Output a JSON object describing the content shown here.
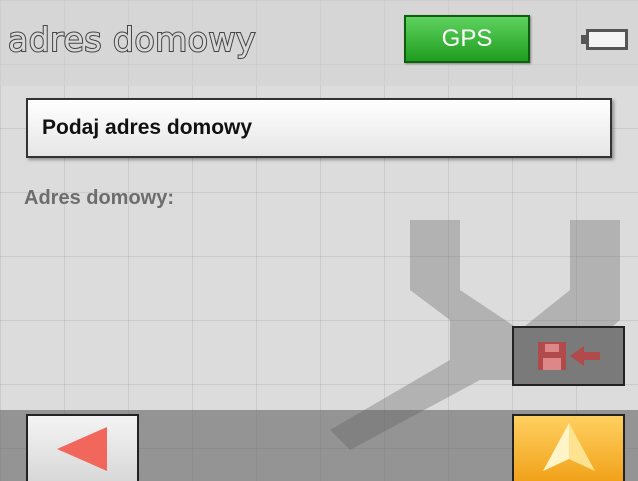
{
  "header": {
    "title": "adres domowy",
    "gps_label": "GPS",
    "battery_icon": "battery-icon"
  },
  "main": {
    "input_placeholder": "Podaj adres domowy",
    "field_label": "Adres domowy:",
    "background_icon": "wrench-icon"
  },
  "actions": {
    "save_icon": "save-arrow-icon",
    "back_icon": "left-arrow-icon",
    "navigate_icon": "navigation-arrow-icon"
  },
  "colors": {
    "gps": "#2fb12f",
    "navigate": "#f5b53a",
    "back_arrow": "#f2675c",
    "save_icon_disabled": "#b14a4a"
  }
}
